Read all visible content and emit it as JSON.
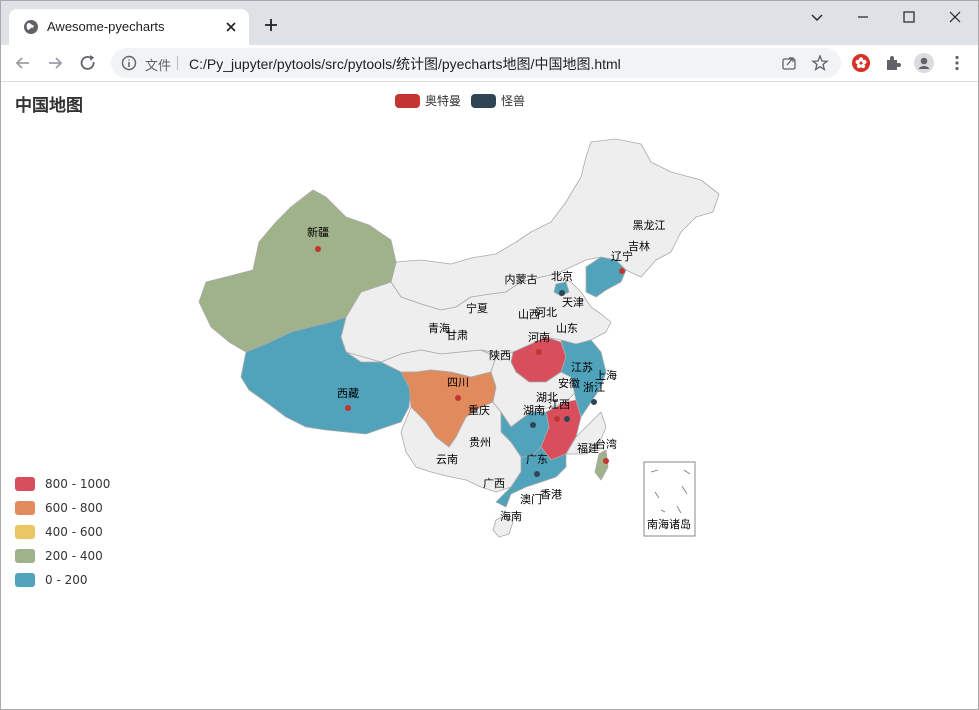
{
  "browser": {
    "tab_title": "Awesome-pyecharts",
    "scheme_label": "文件",
    "url": "C:/Py_jupyter/pytools/src/pytools/统计图/pyecharts地图/中国地图.html"
  },
  "chart": {
    "title": "中国地图",
    "legend": [
      {
        "name": "奥特曼",
        "color": "#c23531"
      },
      {
        "name": "怪兽",
        "color": "#2f4554"
      }
    ],
    "visual_map": [
      {
        "label": "800 - 1000",
        "color": "#d94e5d"
      },
      {
        "label": "600 - 800",
        "color": "#e08a5d"
      },
      {
        "label": "400 - 600",
        "color": "#eac763"
      },
      {
        "label": "200 - 400",
        "color": "#9fb28a"
      },
      {
        "label": "0 - 200",
        "color": "#50a3ba"
      }
    ],
    "inset_label": "南海诸岛"
  },
  "chart_data": {
    "type": "map",
    "map": "china",
    "title": "中国地图",
    "series": [
      {
        "name": "奥特曼"
      },
      {
        "name": "怪兽"
      }
    ],
    "highlighted_regions": [
      {
        "name": "新疆",
        "range": "200 - 400"
      },
      {
        "name": "西藏",
        "range": "0 - 200"
      },
      {
        "name": "四川",
        "range": "600 - 800"
      },
      {
        "name": "河南",
        "range": "800 - 1000"
      },
      {
        "name": "江西",
        "range": "800 - 1000"
      },
      {
        "name": "广东",
        "range": "0 - 200"
      },
      {
        "name": "浙江",
        "range": "0 - 200"
      },
      {
        "name": "辽宁",
        "range": "0 - 200"
      },
      {
        "name": "北京",
        "range": "0 - 200"
      },
      {
        "name": "湖南",
        "range": "0 - 200"
      },
      {
        "name": "台湾",
        "range": "200 - 400"
      }
    ],
    "labels": [
      "黑龙江",
      "吉林",
      "辽宁",
      "内蒙古",
      "北京",
      "天津",
      "河北",
      "山西",
      "山东",
      "宁夏",
      "青海",
      "甘肃",
      "陕西",
      "河南",
      "江苏",
      "上海",
      "安徽",
      "浙江",
      "湖北",
      "湖南",
      "江西",
      "重庆",
      "四川",
      "贵州",
      "云南",
      "西藏",
      "新疆",
      "广西",
      "广东",
      "香港",
      "澳门",
      "海南",
      "福建",
      "台湾"
    ]
  }
}
